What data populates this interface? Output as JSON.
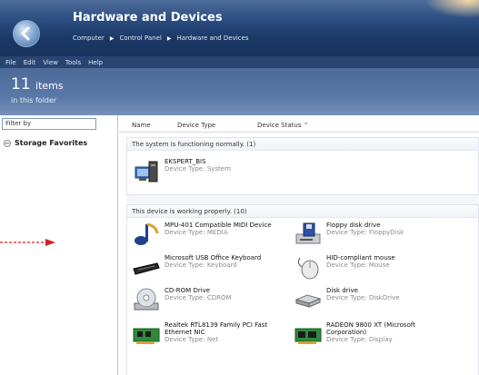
{
  "window": {
    "title": "Hardware and Devices",
    "breadcrumb": [
      "Computer",
      "Control Panel",
      "Hardware and Devices"
    ]
  },
  "menu": [
    "File",
    "Edit",
    "View",
    "Tools",
    "Help"
  ],
  "count": {
    "number": "11",
    "unit": "items",
    "subtitle": "in this folder"
  },
  "sidebar": {
    "filter_placeholder": "Filter by",
    "favorites": "Storage Favorites"
  },
  "columns": [
    "Name",
    "Device Type",
    "Device Status"
  ],
  "groups": [
    {
      "header": "The system is functioning normally. (1)",
      "items": [
        {
          "name": "EKSPERT_BIS",
          "type": "Device Type: System",
          "icon": "computer-icon"
        }
      ]
    },
    {
      "header": "This device is working properly. (10)",
      "items": [
        {
          "name": "MPU-401 Compatible MIDI Device",
          "type": "Device Type: MEDIA",
          "icon": "music-note-icon"
        },
        {
          "name": "Floppy disk drive",
          "type": "Device Type: FloppyDisk",
          "icon": "floppy-drive-icon"
        },
        {
          "name": "Microsoft USB Office Keyboard",
          "type": "Device Type: Keyboard",
          "icon": "keyboard-icon"
        },
        {
          "name": "HID-compliant mouse",
          "type": "Device Type: Mouse",
          "icon": "mouse-icon"
        },
        {
          "name": "CD-ROM Drive",
          "type": "Device Type: CDROM",
          "icon": "cd-drive-icon"
        },
        {
          "name": "Disk drive",
          "type": "Device Type: DiskDrive",
          "icon": "disk-drive-icon"
        },
        {
          "name": "Realtek RTL8139 Family PCI Fast Ethernet NIC",
          "type": "Device Type: Net",
          "icon": "network-card-icon"
        },
        {
          "name": "RADEON 9800 XT (Microsoft Corporation)",
          "type": "Device Type: Display",
          "icon": "display-adapter-icon"
        }
      ]
    }
  ]
}
